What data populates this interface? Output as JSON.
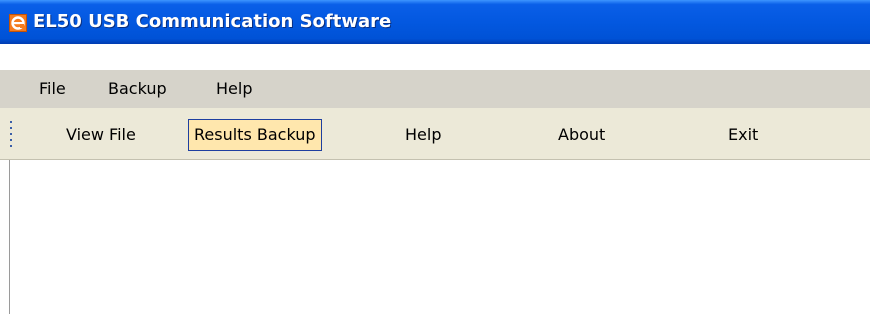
{
  "window": {
    "title": "EL50 USB Communication Software",
    "icon": "ie-style-app-icon"
  },
  "menubar": {
    "items": [
      {
        "label": "File"
      },
      {
        "label": "Backup"
      },
      {
        "label": "Help"
      }
    ]
  },
  "toolbar": {
    "buttons": [
      {
        "label": "View File",
        "active": false
      },
      {
        "label": "Results Backup",
        "active": true
      },
      {
        "label": "Help",
        "active": false
      },
      {
        "label": "About",
        "active": false
      },
      {
        "label": "Exit",
        "active": false
      }
    ]
  },
  "colors": {
    "titlebar": "#0358e0",
    "menubar": "#d6d3ca",
    "toolbar": "#ece9d8",
    "active_button_bg": "#ffe7ad",
    "active_button_border": "#1e3fa0"
  }
}
